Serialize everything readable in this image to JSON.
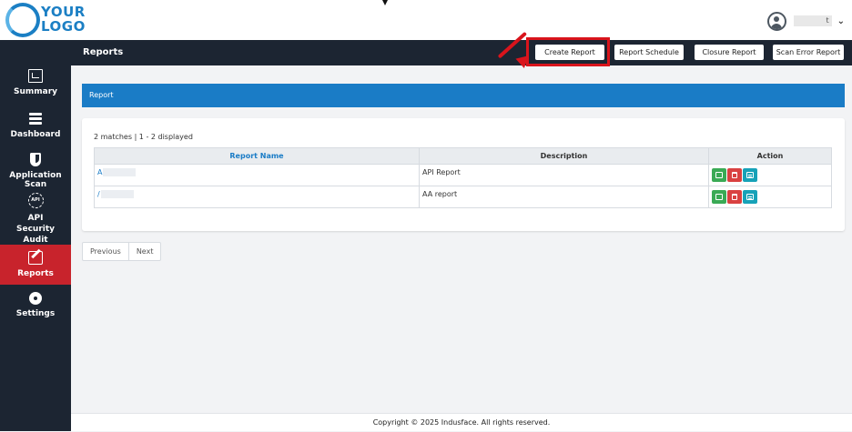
{
  "logo": {
    "line1": "YOUR",
    "line2": "LOGO"
  },
  "user": {
    "name_fragment": "t",
    "avatar_icon": "user-circle-icon",
    "menu_icon": "chevron-down-icon"
  },
  "sidebar": {
    "items": [
      {
        "label": "Summary",
        "icon": "summary-icon"
      },
      {
        "label": "Dashboard",
        "icon": "database-icon"
      },
      {
        "label": "Application Scan",
        "icon": "shield-icon"
      },
      {
        "label": "API Security Audit",
        "icon": "api-icon",
        "icon_text": "API"
      },
      {
        "label": "Reports",
        "icon": "edit-icon",
        "active": true
      },
      {
        "label": "Settings",
        "icon": "gear-icon"
      }
    ]
  },
  "header": {
    "title": "Reports",
    "buttons": [
      "Create Report",
      "Report Schedule",
      "Closure Report",
      "Scan Error Report"
    ]
  },
  "report_section": {
    "title": "Report"
  },
  "table": {
    "summary": "2 matches | 1 - 2 displayed",
    "columns": [
      "Report Name",
      "Description",
      "Action"
    ],
    "rows": [
      {
        "name": "A",
        "description": "API Report"
      },
      {
        "name": "/",
        "description": "AA report"
      }
    ],
    "actions": [
      "edit-icon",
      "trash-icon",
      "list-icon"
    ]
  },
  "pagination": {
    "previous": "Previous",
    "next": "Next"
  },
  "footer": {
    "text": "Copyright © 2025 Indusface. All rights reserved."
  },
  "colors": {
    "sidebar": "#1c2532",
    "accent_blue": "#1a7cc6",
    "active_red": "#c8232c",
    "highlight_red": "#d9141c"
  }
}
